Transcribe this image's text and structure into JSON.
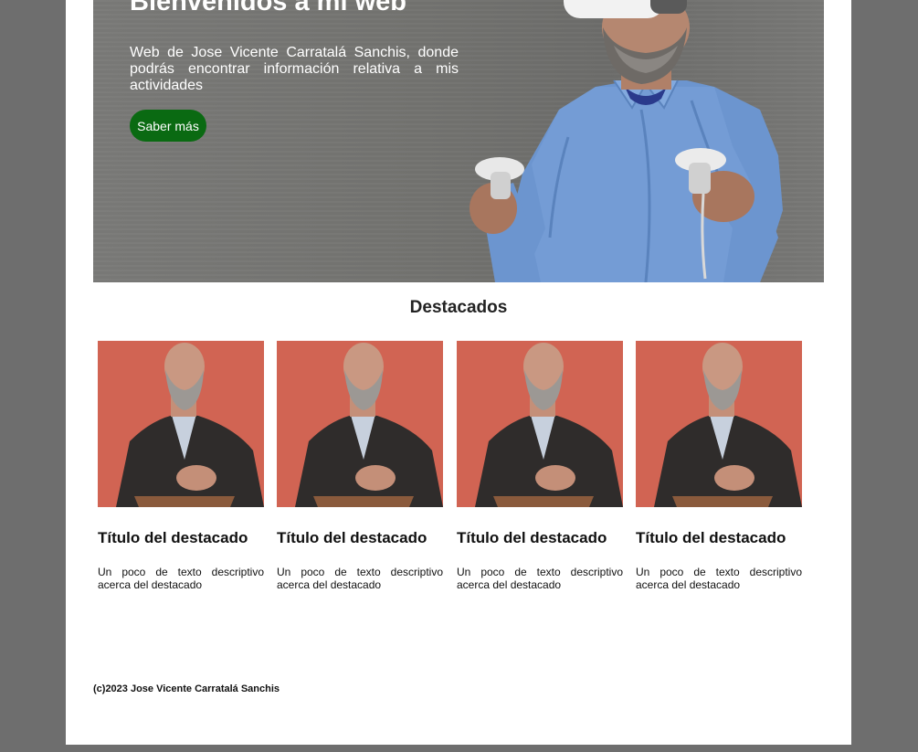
{
  "hero": {
    "title": "Bienvenidos a mi web",
    "text": "Web de Jose Vicente Carratalá Sanchis, donde podrás encontrar información relativa a mis actividades",
    "button_label": "Saber más"
  },
  "featured": {
    "heading": "Destacados",
    "cards": [
      {
        "title": "Título del destacado",
        "text": "Un poco de texto descriptivo acerca del destacado"
      },
      {
        "title": "Título del destacado",
        "text": "Un poco de texto descriptivo acerca del destacado"
      },
      {
        "title": "Título del destacado",
        "text": "Un poco de texto descriptivo acerca del destacado"
      },
      {
        "title": "Título del destacado",
        "text": "Un poco de texto descriptivo acerca del destacado"
      }
    ]
  },
  "footer": {
    "text": "(c)2023 Jose Vicente Carratalá Sanchis"
  },
  "colors": {
    "page_background": "#6e6e6e",
    "content_background": "#ffffff",
    "button_green": "#0a6a12",
    "card_photo_background": "#d86a58"
  }
}
